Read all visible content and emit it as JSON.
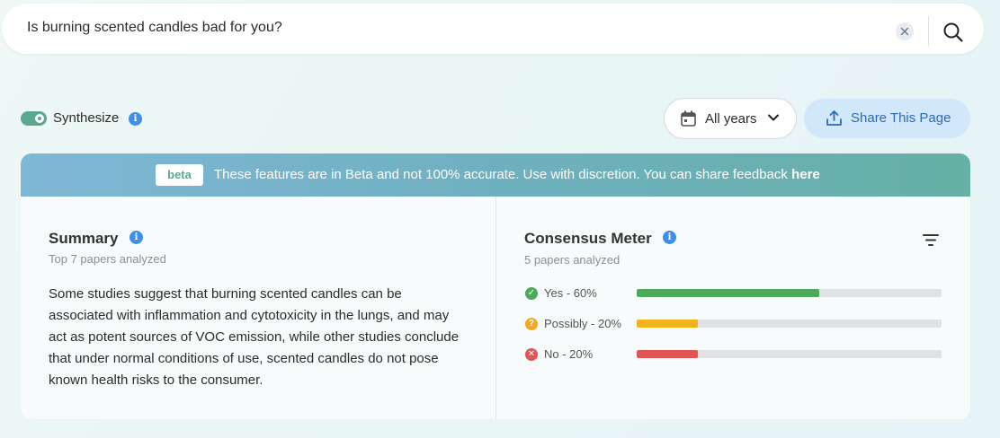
{
  "search": {
    "query": "Is burning scented candles bad for you?",
    "clear_icon": "close-icon",
    "search_icon": "search-icon"
  },
  "toolbar": {
    "synthesize_label": "Synthesize",
    "synthesize_on": true,
    "years_label": "All years",
    "share_label": "Share This Page"
  },
  "banner": {
    "tag": "beta",
    "text": "These features are in Beta and not 100% accurate. Use with discretion. You can share feedback ",
    "link": "here"
  },
  "summary": {
    "title": "Summary",
    "subtitle": "Top 7 papers analyzed",
    "body": "Some studies suggest that burning scented candles can be associated with inflammation and cytotoxicity in the lungs, and may act as potent sources of VOC emission, while other studies conclude that under normal conditions of use, scented candles do not pose known health risks to the consumer."
  },
  "consensus": {
    "title": "Consensus Meter",
    "subtitle": "5 papers analyzed",
    "rows": [
      {
        "label": "Yes - 60%",
        "percent": 60,
        "color": "#4caa5a",
        "icon": "check-circle-icon"
      },
      {
        "label": "Possibly - 20%",
        "percent": 20,
        "color": "#f2b21c",
        "icon": "question-circle-icon"
      },
      {
        "label": "No - 20%",
        "percent": 20,
        "color": "#e05454",
        "icon": "x-circle-icon"
      }
    ]
  },
  "colors": {
    "accent_green": "#5aa88f",
    "info_blue": "#3f8ee8",
    "share_bg": "#d3e7fa",
    "share_text": "#2a6ab8"
  }
}
